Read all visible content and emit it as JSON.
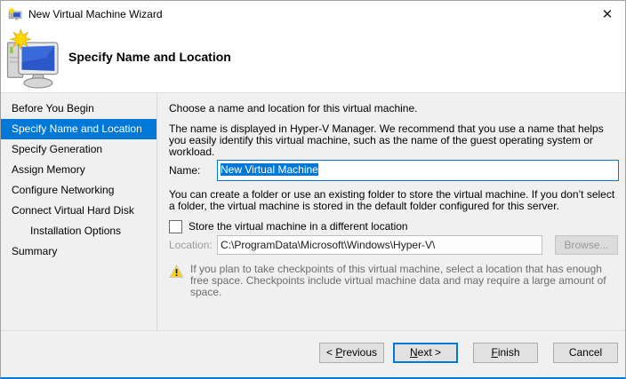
{
  "window": {
    "title": "New Virtual Machine Wizard",
    "close_glyph": "✕"
  },
  "header": {
    "title": "Specify Name and Location"
  },
  "sidebar": {
    "items": [
      {
        "label": "Before You Begin"
      },
      {
        "label": "Specify Name and Location"
      },
      {
        "label": "Specify Generation"
      },
      {
        "label": "Assign Memory"
      },
      {
        "label": "Configure Networking"
      },
      {
        "label": "Connect Virtual Hard Disk"
      },
      {
        "label": "Installation Options"
      },
      {
        "label": "Summary"
      }
    ]
  },
  "content": {
    "intro": "Choose a name and location for this virtual machine.",
    "name_help": "The name is displayed in Hyper-V Manager. We recommend that you use a name that helps you easily identify this virtual machine, such as the name of the guest operating system or workload.",
    "name_label": "Name:",
    "name_value": "New Virtual Machine",
    "folder_help": "You can create a folder or use an existing folder to store the virtual machine. If you don’t select a folder, the virtual machine is stored in the default folder configured for this server.",
    "checkbox_label": "Store the virtual machine in a different location",
    "location_label": "Location:",
    "location_value": "C:\\ProgramData\\Microsoft\\Windows\\Hyper-V\\",
    "browse_label": "Browse...",
    "warning": "If you plan to take checkpoints of this virtual machine, select a location that has enough free space. Checkpoints include virtual machine data and may require a large amount of space."
  },
  "buttons": {
    "previous": {
      "pre": "< ",
      "key": "P",
      "post": "revious"
    },
    "next": {
      "pre": "",
      "key": "N",
      "post": "ext >"
    },
    "finish": {
      "pre": "",
      "key": "F",
      "post": "inish"
    },
    "cancel": {
      "label": "Cancel"
    }
  },
  "colors": {
    "accent": "#0078d7",
    "body_bg": "#f0f0f0",
    "selection": "#0078d7",
    "warning_yellow": "#ffd21e"
  }
}
